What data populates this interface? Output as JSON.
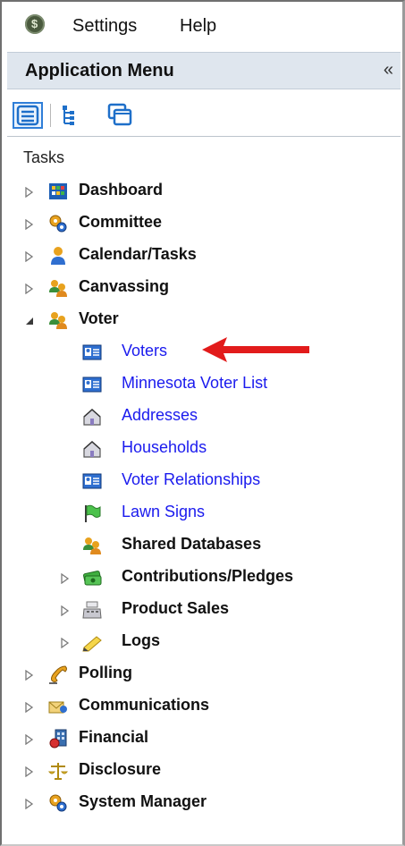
{
  "menubar": {
    "items": [
      {
        "label": "Settings"
      },
      {
        "label": "Help"
      }
    ]
  },
  "panel": {
    "title": "Application Menu",
    "collapse_glyph": "«"
  },
  "toolbar": {
    "buttons": [
      {
        "icon": "list-view-icon",
        "selected": true
      },
      {
        "icon": "tree-view-icon",
        "selected": false
      },
      {
        "icon": "windows-view-icon",
        "selected": false
      }
    ]
  },
  "tasks": {
    "heading": "Tasks",
    "items": [
      {
        "label": "Dashboard",
        "icon": "dashboard-icon",
        "expanded": false
      },
      {
        "label": "Committee",
        "icon": "committee-gears-icon",
        "expanded": false
      },
      {
        "label": "Calendar/Tasks",
        "icon": "person-icon",
        "expanded": false
      },
      {
        "label": "Canvassing",
        "icon": "people-group-icon",
        "expanded": false
      },
      {
        "label": "Voter",
        "icon": "people-group-icon",
        "expanded": true
      },
      {
        "label": "Voters",
        "icon": "voter-card-icon",
        "link": true
      },
      {
        "label": "Minnesota Voter List",
        "icon": "voter-card-icon",
        "link": true
      },
      {
        "label": "Addresses",
        "icon": "house-icon",
        "link": true
      },
      {
        "label": "Households",
        "icon": "house-icon",
        "link": true
      },
      {
        "label": "Voter Relationships",
        "icon": "voter-card-icon",
        "link": true
      },
      {
        "label": "Lawn Signs",
        "icon": "flag-icon",
        "link": true
      },
      {
        "label": "Shared Databases",
        "icon": "people-group-icon",
        "link": false
      },
      {
        "label": "Contributions/Pledges",
        "icon": "money-icon",
        "expanded": false
      },
      {
        "label": "Product Sales",
        "icon": "cash-register-icon",
        "expanded": false
      },
      {
        "label": "Logs",
        "icon": "pencil-icon",
        "expanded": false
      },
      {
        "label": "Polling",
        "icon": "phone-icon",
        "expanded": false
      },
      {
        "label": "Communications",
        "icon": "mail-icon",
        "expanded": false
      },
      {
        "label": "Financial",
        "icon": "financial-icon",
        "expanded": false
      },
      {
        "label": "Disclosure",
        "icon": "scales-icon",
        "expanded": false
      },
      {
        "label": "System Manager",
        "icon": "system-gears-icon",
        "expanded": false
      }
    ]
  },
  "colors": {
    "link": "#1a1aee",
    "arrow": "#e21b1b",
    "panel_header": "#dfe6ee"
  }
}
